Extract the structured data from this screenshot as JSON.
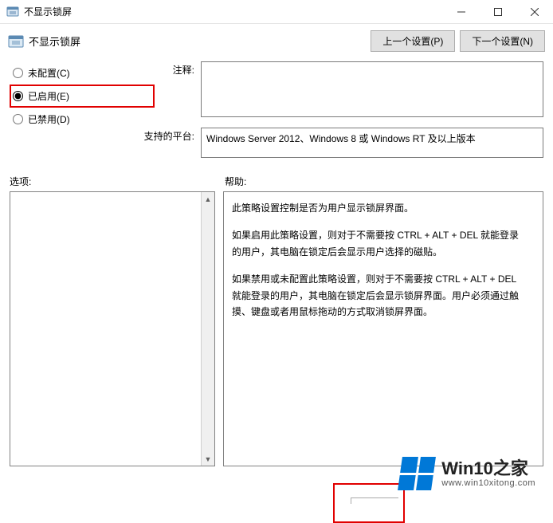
{
  "window": {
    "title": "不显示锁屏"
  },
  "header": {
    "policy_name": "不显示锁屏",
    "prev_button": "上一个设置(P)",
    "next_button": "下一个设置(N)"
  },
  "radios": {
    "not_configured": "未配置(C)",
    "enabled": "已启用(E)",
    "disabled": "已禁用(D)",
    "selected": "enabled"
  },
  "labels": {
    "comment": "注释:",
    "supported": "支持的平台:",
    "options": "选项:",
    "help": "帮助:"
  },
  "fields": {
    "comment_value": "",
    "supported_value": "Windows Server 2012、Windows 8 或 Windows RT 及以上版本"
  },
  "help": {
    "p1": "此策略设置控制是否为用户显示锁屏界面。",
    "p2": "如果启用此策略设置，则对于不需要按 CTRL + ALT + DEL 就能登录的用户，其电脑在锁定后会显示用户选择的磁贴。",
    "p3": "如果禁用或未配置此策略设置，则对于不需要按 CTRL + ALT + DEL 就能登录的用户，其电脑在锁定后会显示锁屏界面。用户必须通过触摸、键盘或者用鼠标拖动的方式取消锁屏界面。"
  },
  "watermark": {
    "big": "Win10之家",
    "small": "www.win10xitong.com"
  }
}
